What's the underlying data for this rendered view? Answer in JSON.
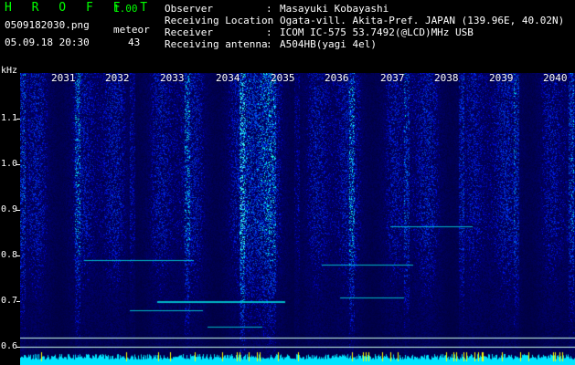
{
  "header": {
    "title": "H R O F F T",
    "version": "1.00",
    "filename": "0509182030.png",
    "meteor_label": "meteor",
    "meteor_count": "43",
    "datetime": "05.09.18 20:30"
  },
  "info": [
    {
      "key": "Observer",
      "value": "Masayuki Kobayashi"
    },
    {
      "key": "Receiving Location",
      "value": "Ogata-vill. Akita-Pref. JAPAN (139.96E, 40.02N)"
    },
    {
      "key": "Receiver",
      "value": "ICOM IC-575 53.7492(@LCD)MHz USB"
    },
    {
      "key": "Receiving antenna",
      "value": "A504HB(yagi 4el)"
    }
  ],
  "axis": {
    "unit": "kHz",
    "freq_labels": [
      "1.1",
      "1.0",
      "0.9",
      "0.8",
      "0.7",
      "0.6"
    ],
    "time_labels": [
      "2031",
      "2032",
      "2033",
      "2034",
      "2035",
      "2036",
      "2037",
      "2038",
      "2039",
      "2040"
    ]
  },
  "colors": {
    "background": "#000000",
    "title_green": "#00ff00",
    "spectrum_low": "#000a6e",
    "spectrum_high": "#00ffff",
    "hits": "#ffff00"
  }
}
